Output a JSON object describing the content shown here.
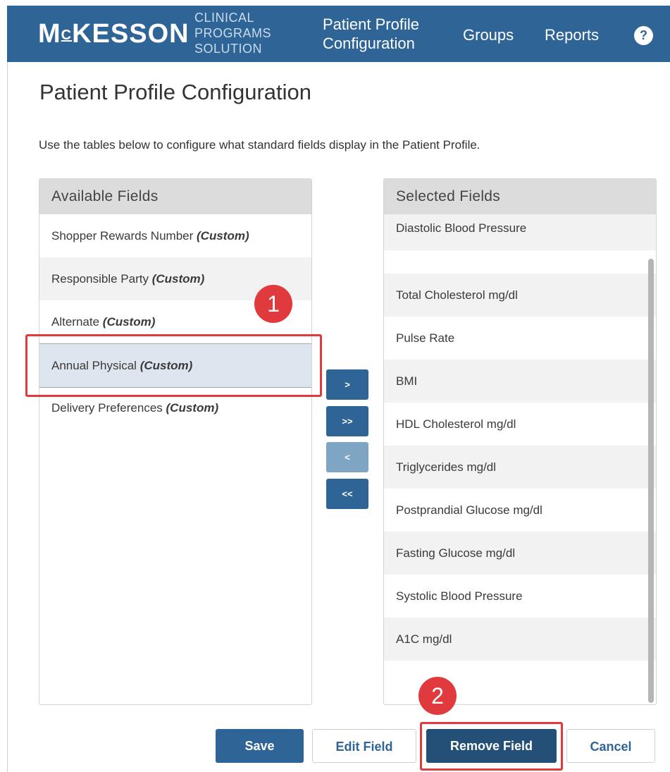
{
  "header": {
    "brand": "MCKESSON",
    "subline": [
      "CLINICAL",
      "PROGRAMS",
      "SOLUTION"
    ],
    "nav": {
      "config_line1": "Patient Profile",
      "config_line2": "Configuration",
      "groups": "Groups",
      "reports": "Reports"
    },
    "help_icon": "question-circle-icon",
    "help_label": "?"
  },
  "page": {
    "title": "Patient Profile Configuration",
    "intro": "Use the tables below to configure what standard fields display in the Patient Profile."
  },
  "available": {
    "header": "Available Fields",
    "items": [
      {
        "name": "Shopper Rewards Number",
        "tag": "(Custom)"
      },
      {
        "name": "Responsible Party",
        "tag": "(Custom)"
      },
      {
        "name": "Alternate",
        "tag": "(Custom)"
      },
      {
        "name": "Annual Physical",
        "tag": "(Custom)"
      },
      {
        "name": "Delivery Preferences",
        "tag": "(Custom)"
      }
    ]
  },
  "arrows": {
    "move_right": ">",
    "move_all_right": ">>",
    "move_left": "<",
    "move_all_left": "<<"
  },
  "selected": {
    "header": "Selected Fields",
    "items": [
      "Diastolic Blood Pressure",
      "",
      "Total Cholesterol mg/dl",
      "Pulse Rate",
      "BMI",
      "HDL Cholesterol mg/dl",
      "Triglycerides mg/dl",
      "Postprandial Glucose mg/dl",
      "Fasting Glucose mg/dl",
      "Systolic Blood Pressure",
      "A1C mg/dl",
      ""
    ]
  },
  "annotations": {
    "step1": "1",
    "step2": "2",
    "color": "#e0393e"
  },
  "buttons": {
    "save": "Save",
    "edit": "Edit Field",
    "remove": "Remove Field",
    "cancel": "Cancel"
  },
  "colors": {
    "brand": "#2e6596",
    "header_text": "#ffffff",
    "highlight": "#dde5ee"
  }
}
